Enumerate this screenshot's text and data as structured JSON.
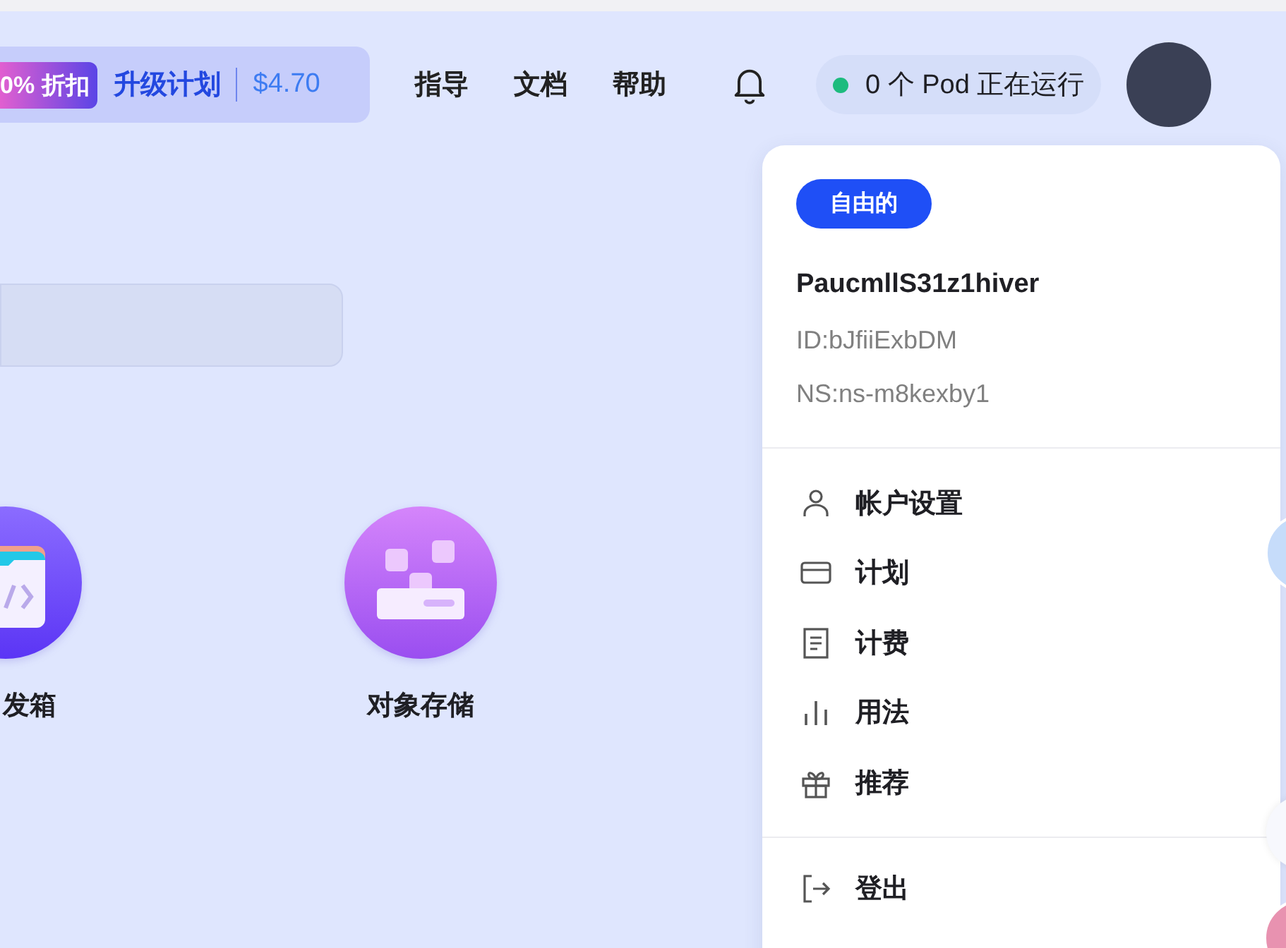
{
  "header": {
    "promo": {
      "discount": "0% 折扣",
      "label": "升级计划",
      "price": "$4.70"
    },
    "nav": [
      "指导",
      "文档",
      "帮助"
    ],
    "pods": {
      "status": "0 个 Pod 正在运行"
    }
  },
  "apps": [
    {
      "label": "发箱",
      "kind": "devbox"
    },
    {
      "label": "对象存储",
      "kind": "storage"
    }
  ],
  "menu": {
    "plan_badge": "自由的",
    "username": "PaucmllS31z1hiver",
    "id": "ID:bJfiiExbDM",
    "ns": "NS:ns-m8kexby1",
    "items": [
      {
        "label": "帐户设置",
        "kind": "user"
      },
      {
        "label": "计划",
        "kind": "card"
      },
      {
        "label": "计费",
        "kind": "receipt"
      },
      {
        "label": "用法",
        "kind": "chart"
      },
      {
        "label": "推荐",
        "kind": "gift"
      }
    ],
    "logout": "登出"
  }
}
